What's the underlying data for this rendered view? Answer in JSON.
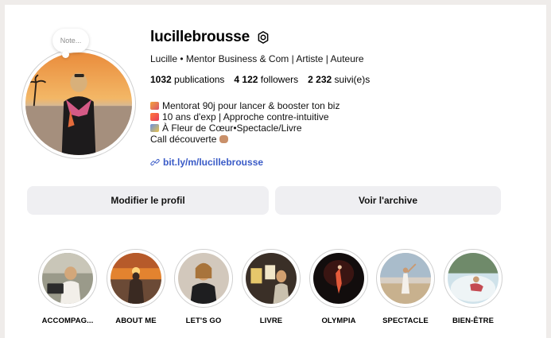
{
  "profile": {
    "note": "Note...",
    "username": "lucillebrousse",
    "full_name": "Lucille • Mentor Business & Com | Artiste | Auteure",
    "stats": {
      "publications_count": "1032",
      "publications_label": "publications",
      "followers_count": "4 122",
      "followers_label": "followers",
      "following_count": "2 232",
      "following_label": "suivi(e)s"
    },
    "bio": [
      "Mentorat 90j pour lancer & booster ton biz",
      "10 ans d'exp | Approche contre-intuitive",
      "À Fleur de Cœur•Spectacle/Livre",
      "Call découverte"
    ],
    "link": "bit.ly/m/lucillebrousse"
  },
  "actions": {
    "edit_label": "Modifier le profil",
    "archive_label": "Voir l'archive"
  },
  "highlights": [
    {
      "label": "ACCOMPAG..."
    },
    {
      "label": "ABOUT ME"
    },
    {
      "label": "LET'S GO"
    },
    {
      "label": "LIVRE"
    },
    {
      "label": "OLYMPIA"
    },
    {
      "label": "SPECTACLE"
    },
    {
      "label": "BIEN-ÊTRE"
    }
  ],
  "colors": {
    "link": "#3a5bc7",
    "button_bg": "#efeff2",
    "page_bg": "#efecea"
  }
}
